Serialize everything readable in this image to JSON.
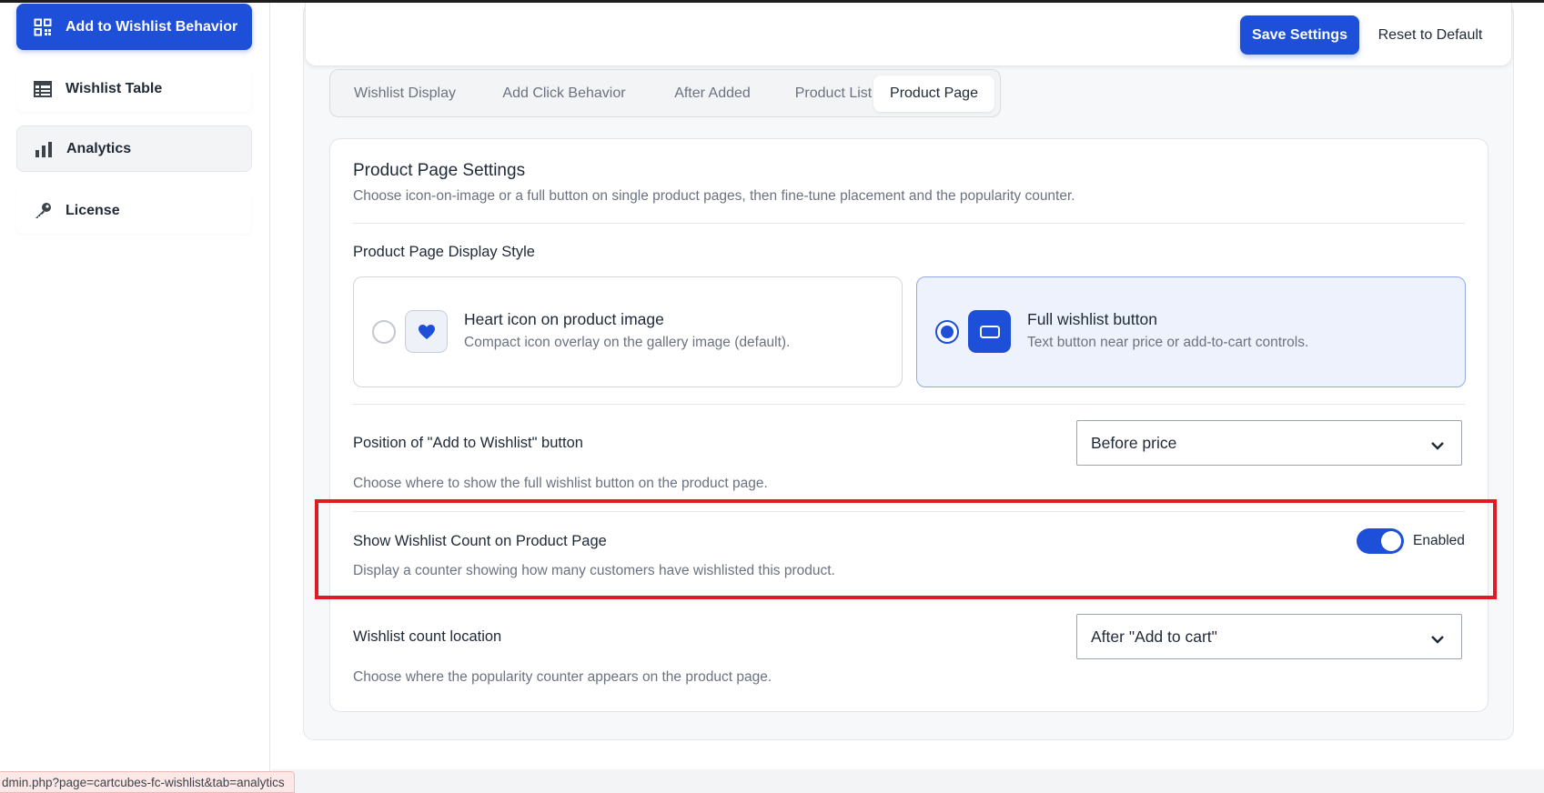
{
  "sidebar": {
    "items": [
      {
        "label": "Add to Wishlist Behavior",
        "icon": "qr-grid-icon"
      },
      {
        "label": "Wishlist Table",
        "icon": "table-icon"
      },
      {
        "label": "Analytics",
        "icon": "bar-chart-icon"
      },
      {
        "label": "License",
        "icon": "key-icon"
      }
    ]
  },
  "header": {
    "save_label": "Save Settings",
    "reset_label": "Reset to Default"
  },
  "tabs": [
    {
      "label": "Wishlist Display"
    },
    {
      "label": "Add Click Behavior"
    },
    {
      "label": "After Added"
    },
    {
      "label": "Product List"
    },
    {
      "label": "Product Page",
      "active": true
    }
  ],
  "settings": {
    "title": "Product Page Settings",
    "description": "Choose icon-on-image or a full button on single product pages, then fine-tune placement and the popularity counter.",
    "display_style": {
      "label": "Product Page Display Style",
      "options": [
        {
          "title": "Heart icon on product image",
          "desc": "Compact icon overlay on the gallery image (default).",
          "icon": "heart-icon",
          "selected": false
        },
        {
          "title": "Full wishlist button",
          "desc": "Text button near price or add-to-cart controls.",
          "icon": "button-icon",
          "selected": true
        }
      ]
    },
    "position": {
      "label": "Position of \"Add to Wishlist\" button",
      "value": "Before price",
      "help": "Choose where to show the full wishlist button on the product page."
    },
    "show_count": {
      "label": "Show Wishlist Count on Product Page",
      "help": "Display a counter showing how many customers have wishlisted this product.",
      "state_label": "Enabled",
      "enabled": true
    },
    "count_location": {
      "label": "Wishlist count location",
      "value": "After \"Add to cart\"",
      "help": "Choose where the popularity counter appears on the product page."
    }
  },
  "status_bar": {
    "url": "dmin.php?page=cartcubes-fc-wishlist&tab=analytics"
  },
  "colors": {
    "accent": "#1d4fd8",
    "highlight": "#e01b24"
  }
}
